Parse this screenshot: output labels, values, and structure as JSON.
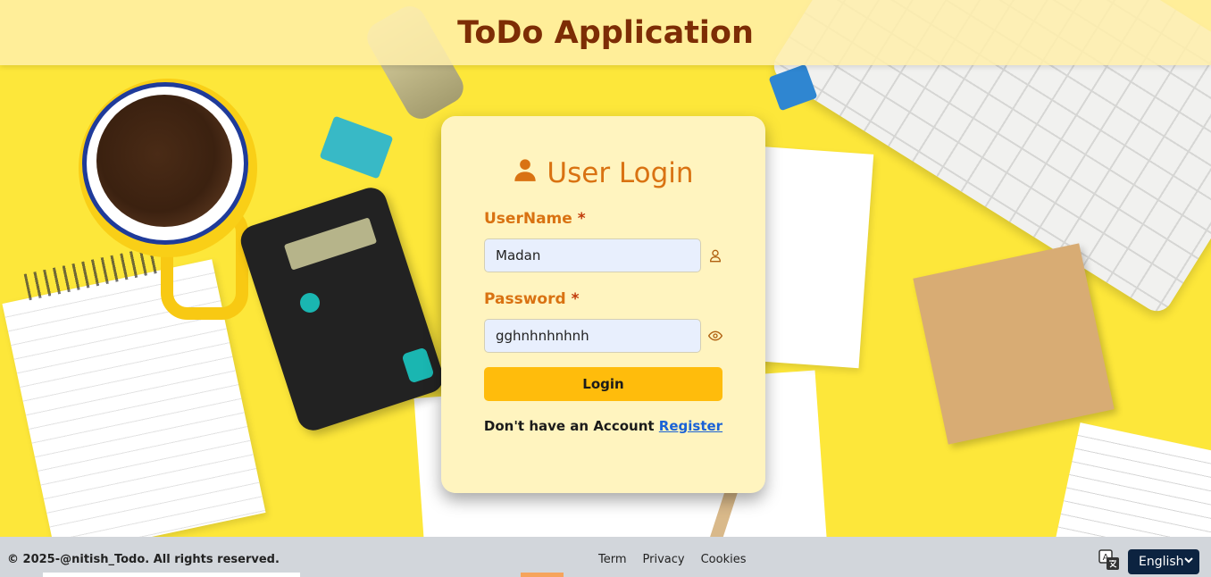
{
  "header": {
    "title": "ToDo Application"
  },
  "login": {
    "title": "User Login",
    "title_icon": "user-icon",
    "username": {
      "label": "UserName",
      "required_mark": "*",
      "value": "Madan",
      "icon": "user-outline-icon"
    },
    "password": {
      "label": "Password",
      "required_mark": "*",
      "value": "gghnhnhnhnh",
      "icon": "eye-icon"
    },
    "submit_label": "Login",
    "register_prompt": "Don't have an Account",
    "register_link": "Register"
  },
  "footer": {
    "copyright": "© 2025-@nitish_Todo. All rights reserved.",
    "links": [
      "Term",
      "Privacy",
      "Cookies"
    ],
    "language": "English",
    "language_icon": "translate-icon"
  },
  "colors": {
    "header_title": "#7d2d05",
    "accent_orange": "#d97212",
    "login_button": "#ffbc0c",
    "card_bg": "#fff4bf",
    "link_blue": "#1a62d6",
    "footer_bg": "#d2d6db",
    "language_select_bg": "#0c2340"
  }
}
